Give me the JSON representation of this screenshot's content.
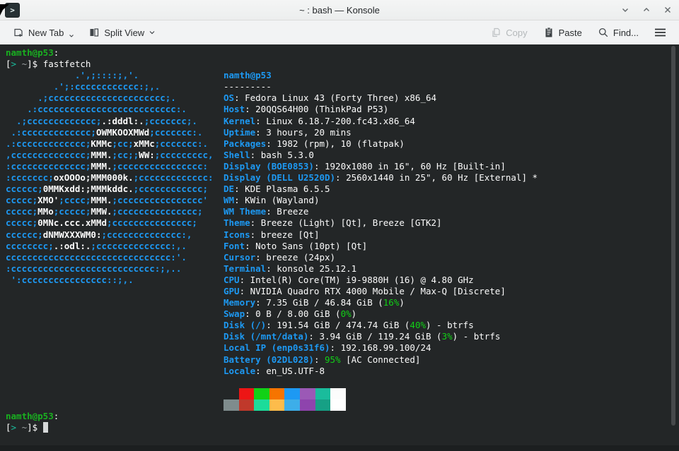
{
  "window": {
    "title": "~ : bash — Konsole",
    "app_icon_glyph": ">",
    "controls": {
      "minimize": "chevron-down",
      "maximize": "chevron-up",
      "close": "x"
    }
  },
  "toolbar": {
    "new_tab_label": "New Tab",
    "split_view_label": "Split View",
    "copy_label": "Copy",
    "paste_label": "Paste",
    "find_label": "Find...",
    "copy_enabled": false
  },
  "terminal": {
    "colors": {
      "background": "#232627",
      "foreground": "#fcfcfc",
      "label_blue": "#1d99f3",
      "prompt_green": "#19b020",
      "percent_green": "#11d116",
      "teal": "#1abc9c"
    },
    "palette": {
      "row1": [
        "#232627",
        "#ed1515",
        "#11d116",
        "#f67400",
        "#1d99f3",
        "#9b59b6",
        "#1abc9c",
        "#fcfcfc"
      ],
      "row2": [
        "#7f8c8d",
        "#c0392b",
        "#1cdc9a",
        "#fdbc4b",
        "#3daee9",
        "#8e44ad",
        "#16a085",
        "#ffffff"
      ]
    },
    "rows": [
      {
        "full": [
          [
            "namth@p53",
            "g"
          ],
          [
            ":",
            "fg"
          ]
        ]
      },
      {
        "full": [
          [
            "[",
            "fg"
          ],
          [
            ">",
            "cy"
          ],
          [
            " ",
            "fg"
          ],
          [
            "~",
            "dim"
          ],
          [
            "]$ fastfetch",
            "fg"
          ]
        ]
      },
      {
        "art": [
          [
            "             .',;::::;,'.",
            "b"
          ]
        ],
        "info": [
          [
            "namth@p53",
            "lb"
          ]
        ]
      },
      {
        "art": [
          [
            "         .';:cccccccccccc:;,.",
            "b"
          ]
        ],
        "info": [
          [
            "---------",
            "fg"
          ]
        ]
      },
      {
        "art": [
          [
            "      .;cccccccccccccccccccccc;.",
            "b"
          ]
        ],
        "info": [
          [
            "OS",
            "lb"
          ],
          [
            ": Fedora Linux 43 (Forty Three) x86_64",
            "fg"
          ]
        ]
      },
      {
        "art": [
          [
            "    .:cccccccccccccccccccccccccc:.",
            "b"
          ]
        ],
        "info": [
          [
            "Host",
            "lb"
          ],
          [
            ": 20QQS64H00 (ThinkPad P53)",
            "fg"
          ]
        ]
      },
      {
        "art": [
          [
            "  .;ccccccccccccc;",
            "b"
          ],
          [
            ".:dddl:.",
            "w"
          ],
          [
            ";ccccccc;.",
            "b"
          ]
        ],
        "info": [
          [
            "Kernel",
            "lb"
          ],
          [
            ": Linux 6.18.7-200.fc43.x86_64",
            "fg"
          ]
        ]
      },
      {
        "art": [
          [
            " .:ccccccccccccc;",
            "b"
          ],
          [
            "OWMKOOXMWd",
            "w"
          ],
          [
            ";ccccccc:.",
            "b"
          ]
        ],
        "info": [
          [
            "Uptime",
            "lb"
          ],
          [
            ": 3 hours, 20 mins",
            "fg"
          ]
        ]
      },
      {
        "art": [
          [
            ".:ccccccccccccc;",
            "b"
          ],
          [
            "KMMc",
            "w"
          ],
          [
            ";cc;",
            "b"
          ],
          [
            "xMMc",
            "w"
          ],
          [
            ";ccccccc:.",
            "b"
          ]
        ],
        "info": [
          [
            "Packages",
            "lb"
          ],
          [
            ": 1982 (rpm), 10 (flatpak)",
            "fg"
          ]
        ]
      },
      {
        "art": [
          [
            ",cccccccccccccc;",
            "b"
          ],
          [
            "MMM.",
            "w"
          ],
          [
            ";cc;;",
            "b"
          ],
          [
            "WW:",
            "w"
          ],
          [
            ";ccccccccc,",
            "b"
          ]
        ],
        "info": [
          [
            "Shell",
            "lb"
          ],
          [
            ": bash 5.3.0",
            "fg"
          ]
        ]
      },
      {
        "art": [
          [
            ":cccccccccccccc;",
            "b"
          ],
          [
            "MMM.",
            "w"
          ],
          [
            ";cccccccccccccccc:",
            "b"
          ]
        ],
        "info": [
          [
            "Display (BOE0853)",
            "lb"
          ],
          [
            ": 1920x1080 in 16\", 60 Hz [Built-in]",
            "fg"
          ]
        ]
      },
      {
        "art": [
          [
            ":ccccccc;",
            "b"
          ],
          [
            "oxOOOo;MMM000k.",
            "w"
          ],
          [
            ";ccccccccccccc:",
            "b"
          ]
        ],
        "info": [
          [
            "Display (DELL U2520D)",
            "lb"
          ],
          [
            ": 2560x1440 in 25\", 60 Hz [External] *",
            "fg"
          ]
        ]
      },
      {
        "art": [
          [
            "cccccc;",
            "b"
          ],
          [
            "0MMKxdd:;MMMkddc.",
            "w"
          ],
          [
            ";cccccccccccc;",
            "b"
          ]
        ],
        "info": [
          [
            "DE",
            "lb"
          ],
          [
            ": KDE Plasma 6.5.5",
            "fg"
          ]
        ]
      },
      {
        "art": [
          [
            "ccccc;",
            "b"
          ],
          [
            "XMO'",
            "w"
          ],
          [
            ";cccc;",
            "b"
          ],
          [
            "MMM.",
            "w"
          ],
          [
            ";cccccccccccccccc'",
            "b"
          ]
        ],
        "info": [
          [
            "WM",
            "lb"
          ],
          [
            ": KWin (Wayland)",
            "fg"
          ]
        ]
      },
      {
        "art": [
          [
            "ccccc;",
            "b"
          ],
          [
            "MMo",
            "w"
          ],
          [
            ";ccccc;",
            "b"
          ],
          [
            "MMW.",
            "w"
          ],
          [
            ";ccccccccccccccc;",
            "b"
          ]
        ],
        "info": [
          [
            "WM Theme",
            "lb"
          ],
          [
            ": Breeze",
            "fg"
          ]
        ]
      },
      {
        "art": [
          [
            "ccccc;",
            "b"
          ],
          [
            "0MNc.ccc.xMMd",
            "w"
          ],
          [
            ";ccccccccccccccc;",
            "b"
          ]
        ],
        "info": [
          [
            "Theme",
            "lb"
          ],
          [
            ": Breeze (Light) [Qt], Breeze [GTK2]",
            "fg"
          ]
        ]
      },
      {
        "art": [
          [
            "cccccc;",
            "b"
          ],
          [
            "dNMWXXXWM0:",
            "w"
          ],
          [
            ";cccccccccccccc:,",
            "b"
          ]
        ],
        "info": [
          [
            "Icons",
            "lb"
          ],
          [
            ": breeze [Qt]",
            "fg"
          ]
        ]
      },
      {
        "art": [
          [
            "cccccccc;",
            "b"
          ],
          [
            ".:odl:.",
            "w"
          ],
          [
            ";cccccccccccccc:,.",
            "b"
          ]
        ],
        "info": [
          [
            "Font",
            "lb"
          ],
          [
            ": Noto Sans (10pt) [Qt]",
            "fg"
          ]
        ]
      },
      {
        "art": [
          [
            "ccccccccccccccccccccccccccccccc:'.",
            "b"
          ]
        ],
        "info": [
          [
            "Cursor",
            "lb"
          ],
          [
            ": breeze (24px)",
            "fg"
          ]
        ]
      },
      {
        "art": [
          [
            ":ccccccccccccccccccccccccccc:;,..",
            "b"
          ]
        ],
        "info": [
          [
            "Terminal",
            "lb"
          ],
          [
            ": konsole 25.12.1",
            "fg"
          ]
        ]
      },
      {
        "art": [
          [
            " ':cccccccccccccccc::;,.",
            "b"
          ]
        ],
        "info": [
          [
            "CPU",
            "lb"
          ],
          [
            ": Intel(R) Core(TM) i9-9880H (16) @ 4.80 GHz",
            "fg"
          ]
        ]
      },
      {
        "info": [
          [
            "GPU",
            "lb"
          ],
          [
            ": NVIDIA Quadro RTX 4000 Mobile / Max-Q [Discrete]",
            "fg"
          ]
        ]
      },
      {
        "info": [
          [
            "Memory",
            "lb"
          ],
          [
            ": 7.35 GiB / 46.84 GiB (",
            "fg"
          ],
          [
            "16%",
            "gr"
          ],
          [
            ")",
            "fg"
          ]
        ]
      },
      {
        "info": [
          [
            "Swap",
            "lb"
          ],
          [
            ": 0 B / 8.00 GiB (",
            "fg"
          ],
          [
            "0%",
            "gr"
          ],
          [
            ")",
            "fg"
          ]
        ]
      },
      {
        "info": [
          [
            "Disk (/)",
            "lb"
          ],
          [
            ": 191.54 GiB / 474.74 GiB (",
            "fg"
          ],
          [
            "40%",
            "gr"
          ],
          [
            ") - btrfs",
            "fg"
          ]
        ]
      },
      {
        "info": [
          [
            "Disk (/mnt/data)",
            "lb"
          ],
          [
            ": 3.94 GiB / 119.24 GiB (",
            "fg"
          ],
          [
            "3%",
            "gr"
          ],
          [
            ") - btrfs",
            "fg"
          ]
        ]
      },
      {
        "info": [
          [
            "Local IP (enp0s31f6)",
            "lb"
          ],
          [
            ": 192.168.99.100/24",
            "fg"
          ]
        ]
      },
      {
        "info": [
          [
            "Battery (02DL028)",
            "lb"
          ],
          [
            ": ",
            "fg"
          ],
          [
            "95%",
            "gr"
          ],
          [
            " [AC Connected]",
            "fg"
          ]
        ]
      },
      {
        "info": [
          [
            "Locale",
            "lb"
          ],
          [
            ": en_US.UTF-8",
            "fg"
          ]
        ]
      },
      {
        "blank": true
      },
      {
        "palette": "row1"
      },
      {
        "palette": "row2"
      },
      {
        "full": [
          [
            "namth@p53",
            "g"
          ],
          [
            ":",
            "fg"
          ]
        ]
      },
      {
        "full": [
          [
            "[",
            "fg"
          ],
          [
            ">",
            "cy"
          ],
          [
            " ",
            "fg"
          ],
          [
            "~",
            "dim"
          ],
          [
            "]$ ",
            "fg"
          ],
          [
            " ",
            "cur"
          ]
        ]
      }
    ]
  }
}
